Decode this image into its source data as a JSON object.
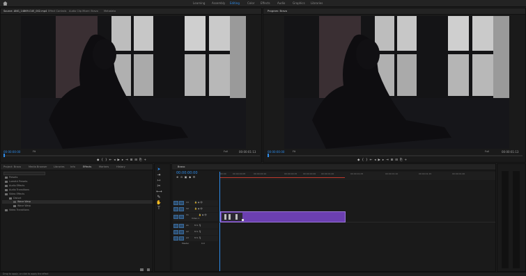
{
  "workspaces": [
    "Learning",
    "Assembly",
    "Editing",
    "Color",
    "Effects",
    "Audio",
    "Graphics",
    "Libraries"
  ],
  "active_workspace_index": 2,
  "source": {
    "tabs": [
      "Source: ANG_14869.CUE_002.mp4",
      "Effect Controls",
      "Audio Clip Mixer: Bravo",
      "Metadata"
    ],
    "timecode": "00:00:00:00",
    "fit": "Fit",
    "fit_right": "Full",
    "duration": "00:00:01:13"
  },
  "program": {
    "tabs": [
      "Program: Bravo"
    ],
    "timecode": "00:00:00:00",
    "fit": "Fit",
    "fit_right": "Full",
    "duration": "00:00:01:13"
  },
  "effects_panel": {
    "tabs": [
      "Project: Bravo",
      "Media Browser",
      "Libraries",
      "Info",
      "Effects",
      "Markers",
      "History"
    ],
    "active_tab_index": 4,
    "tree": [
      "Presets",
      "Lumetri Presets",
      "Audio Effects",
      "Audio Transitions",
      "Video Effects",
      "Distort",
      "Wave Warp",
      "Wave Warp",
      "Video Transitions"
    ]
  },
  "timeline": {
    "tab": "Bravo",
    "timecode": "00:00:00:00",
    "ruler": [
      "00:00",
      "00:00:00:05",
      "00:00:00:10",
      "00:00:00:15",
      "00:00:00:20",
      "00:00:01:00",
      "00:00:01:05",
      "00:00:01:10",
      "00:00:01:15",
      "00:00:01:20"
    ],
    "tracks": [
      "V3",
      "V2",
      "V1",
      "A1",
      "A2",
      "A3"
    ],
    "track_name": "Video 1",
    "master": "Master",
    "master_level": "0.0"
  },
  "status_text": "Drag to apply, or click to apply the effect",
  "colors": {
    "accent": "#2d8ceb",
    "clip": "#6b3fb0",
    "playhead": "#2d8ceb",
    "workarea": "#c0392b"
  }
}
